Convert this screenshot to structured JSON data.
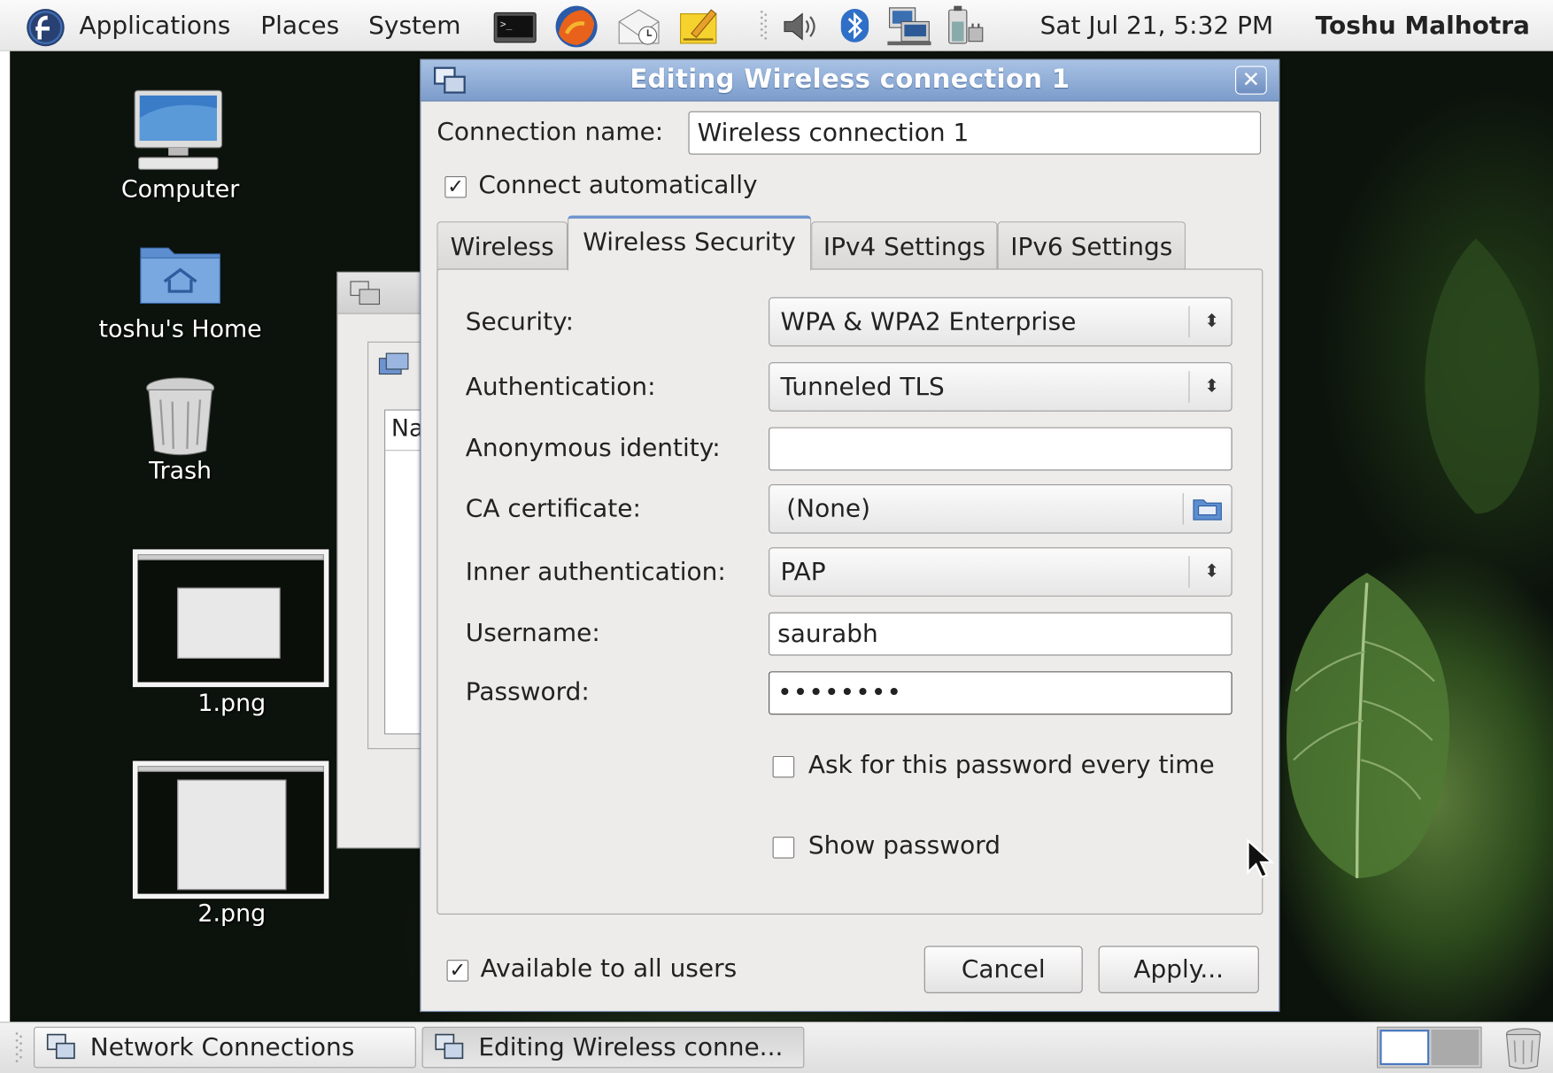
{
  "top_panel": {
    "menus": [
      "Applications",
      "Places",
      "System"
    ],
    "clock": "Sat Jul 21,  5:32 PM",
    "user": "Toshu Malhotra"
  },
  "desktop": {
    "icons": [
      {
        "label": "Computer"
      },
      {
        "label": "toshu's Home"
      },
      {
        "label": "Trash"
      },
      {
        "label": "1.png"
      },
      {
        "label": "2.png"
      }
    ],
    "bg_window_column": "Na"
  },
  "dialog": {
    "title": "Editing Wireless connection 1",
    "connection_name_label": "Connection name:",
    "connection_name_value": "Wireless connection 1",
    "connect_automatically": {
      "label": "Connect automatically",
      "checked": true
    },
    "tabs": [
      "Wireless",
      "Wireless Security",
      "IPv4 Settings",
      "IPv6 Settings"
    ],
    "active_tab": "Wireless Security",
    "security_label": "Security:",
    "security_value": "WPA & WPA2 Enterprise",
    "authentication_label": "Authentication:",
    "authentication_value": "Tunneled TLS",
    "anonymous_identity_label": "Anonymous identity:",
    "anonymous_identity_value": "",
    "ca_certificate_label": "CA certificate:",
    "ca_certificate_value": "(None)",
    "inner_auth_label": "Inner authentication:",
    "inner_auth_value": "PAP",
    "username_label": "Username:",
    "username_value": "saurabh",
    "password_label": "Password:",
    "password_value": "••••••••",
    "ask_password": {
      "label": "Ask for this password every time",
      "checked": false
    },
    "show_password": {
      "label": "Show password",
      "checked": false
    },
    "available_all_users": {
      "label": "Available to all users",
      "checked": true
    },
    "cancel_label": "Cancel",
    "apply_label": "Apply..."
  },
  "taskbar": {
    "tasks": [
      "Network Connections",
      "Editing Wireless conne..."
    ]
  },
  "colors": {
    "title_bar": "#7c9ccb",
    "active_tab_accent": "#6d93cf",
    "dialog_bg": "#edeceb"
  }
}
